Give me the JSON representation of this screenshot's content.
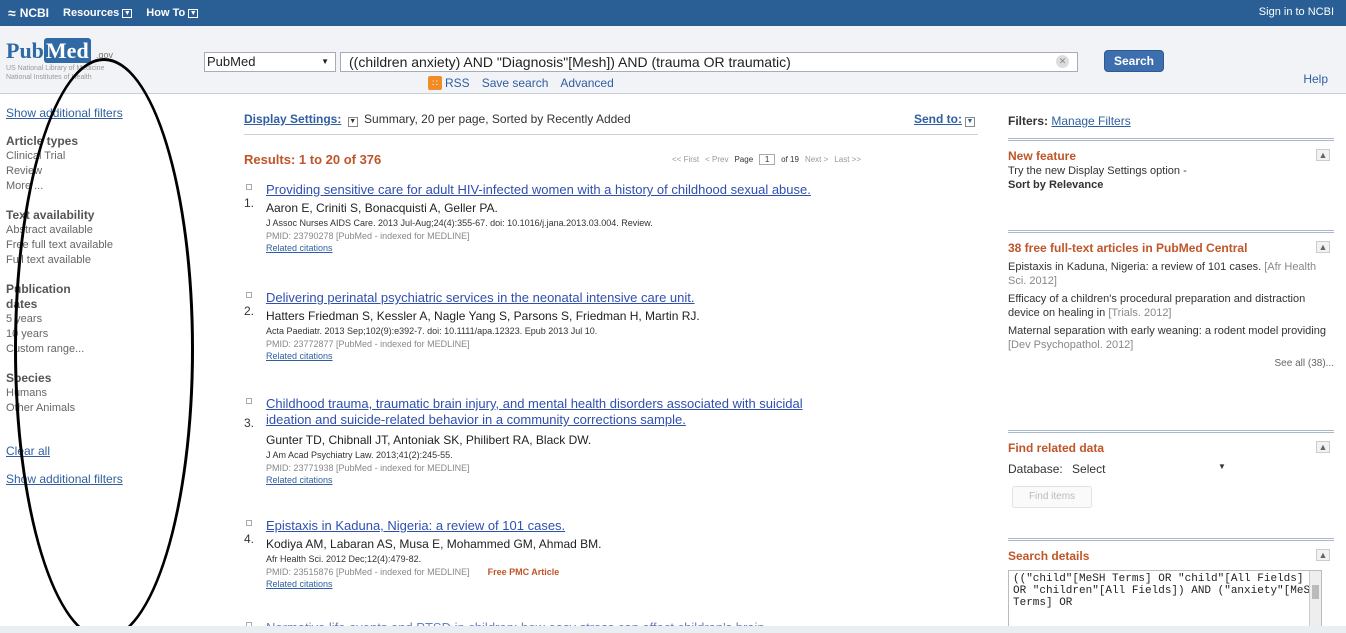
{
  "topbar": {
    "logo_text": "NCBI",
    "resources": "Resources",
    "howto": "How To",
    "signin": "Sign in to NCBI"
  },
  "header": {
    "logo_word_a": "Pub",
    "logo_word_b": "Med",
    "logo_gov": ".gov",
    "logo_sub1": "US National Library of Medicine",
    "logo_sub2": "National Institutes of Health",
    "db_value": "PubMed",
    "query": "((children anxiety) AND \"Diagnosis\"[Mesh]) AND (trauma OR traumatic)",
    "search_label": "Search",
    "rss": "RSS",
    "save_search": "Save search",
    "advanced": "Advanced",
    "help": "Help"
  },
  "sidebar": {
    "show_filters_top": "Show additional filters",
    "groups": [
      {
        "title": "Article types",
        "items": [
          "Clinical Trial",
          "Review",
          "More ..."
        ]
      },
      {
        "title": "Text availability",
        "items": [
          "Abstract available",
          "Free full text available",
          "Full text available"
        ]
      },
      {
        "title": "Publication dates",
        "items": [
          "5 years",
          "10 years",
          "Custom range..."
        ]
      },
      {
        "title": "Species",
        "items": [
          "Humans",
          "Other Animals"
        ]
      }
    ],
    "clear_all": "Clear all",
    "show_filters_bottom": "Show additional filters"
  },
  "main": {
    "display_settings": "Display Settings:",
    "display_value": "Summary, 20 per page, Sorted by Recently Added",
    "send_to": "Send to:",
    "results_heading": "Results: 1 to 20 of 376",
    "pager": {
      "first": "<< First",
      "prev": "< Prev",
      "page_label": "Page",
      "page_value": "1",
      "of": "of 19",
      "next": "Next >",
      "last": "Last >>"
    },
    "results": [
      {
        "num": "1.",
        "title": "Providing sensitive care for adult HIV-infected women with a history of childhood sexual abuse.",
        "authors": "Aaron E, Criniti S, Bonacquisti A, Geller PA.",
        "journal": "J Assoc Nurses AIDS Care. 2013 Jul-Aug;24(4):355-67. doi: 10.1016/j.jana.2013.03.004. Review.",
        "pmid": "PMID: 23790278 [PubMed - indexed for MEDLINE]",
        "related": "Related citations",
        "free": ""
      },
      {
        "num": "2.",
        "title": "Delivering perinatal psychiatric services in the neonatal intensive care unit.",
        "authors": "Hatters Friedman S, Kessler A, Nagle Yang S, Parsons S, Friedman H, Martin RJ.",
        "journal": "Acta Paediatr. 2013 Sep;102(9):e392-7. doi: 10.1111/apa.12323. Epub 2013 Jul 10.",
        "pmid": "PMID: 23772877 [PubMed - indexed for MEDLINE]",
        "related": "Related citations",
        "free": ""
      },
      {
        "num": "3.",
        "title_line1": "Childhood trauma, traumatic brain injury, and mental health disorders associated with suicidal",
        "title_line2": "ideation and suicide-related behavior in a community corrections sample.",
        "authors": "Gunter TD, Chibnall JT, Antoniak SK, Philibert RA, Black DW.",
        "journal": "J Am Acad Psychiatry Law. 2013;41(2):245-55.",
        "pmid": "PMID: 23771938 [PubMed - indexed for MEDLINE]",
        "related": "Related citations",
        "free": ""
      },
      {
        "num": "4.",
        "title": "Epistaxis in Kaduna, Nigeria: a review of 101 cases.",
        "authors": "Kodiya AM, Labaran AS, Musa E, Mohammed GM, Ahmad BM.",
        "journal": "Afr Health Sci. 2012 Dec;12(4):479-82.",
        "pmid": "PMID: 23515876 [PubMed - indexed for MEDLINE]",
        "related": "Related citations",
        "free": "Free PMC Article"
      }
    ],
    "result5_partial": "Normative life events and PTSD in children: how easy stress can affect children's brain"
  },
  "right": {
    "filters_label": "Filters:",
    "manage_filters": "Manage Filters",
    "new_feature": {
      "title": "New feature",
      "text": "Try the new Display Settings option -",
      "bold": "Sort by Relevance"
    },
    "pmc": {
      "title": "38 free full-text articles in PubMed Central",
      "items": [
        {
          "text": "Epistaxis in Kaduna, Nigeria: a review of 101 cases.",
          "cite": "[Afr Health Sci. 2012]"
        },
        {
          "text": "Efficacy of a children's procedural preparation and distraction device on healing in",
          "cite": "[Trials. 2012]"
        },
        {
          "text": "Maternal separation with early weaning: a rodent model providing",
          "cite": "[Dev Psychopathol. 2012]"
        }
      ],
      "see_all": "See all (38)..."
    },
    "related": {
      "title": "Find related data",
      "db_label": "Database:",
      "db_value": "Select",
      "find_btn": "Find items"
    },
    "details": {
      "title": "Search details",
      "code": "((\"child\"[MeSH Terms] OR \"child\"[All Fields] OR \"children\"[All Fields]) AND (\"anxiety\"[MeSH Terms] OR"
    }
  }
}
